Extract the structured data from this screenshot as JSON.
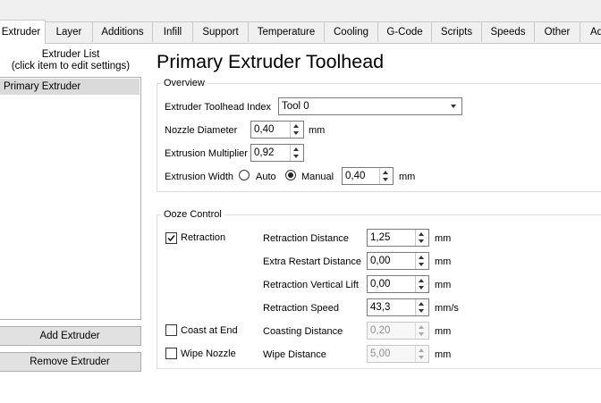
{
  "tabs": [
    {
      "label": "Extruder",
      "active": true
    },
    {
      "label": "Layer"
    },
    {
      "label": "Additions"
    },
    {
      "label": "Infill"
    },
    {
      "label": "Support"
    },
    {
      "label": "Temperature"
    },
    {
      "label": "Cooling"
    },
    {
      "label": "G-Code"
    },
    {
      "label": "Scripts"
    },
    {
      "label": "Speeds"
    },
    {
      "label": "Other"
    },
    {
      "label": "Ad"
    }
  ],
  "left_panel": {
    "list_title_line1": "Extruder List",
    "list_title_line2": "(click item to edit settings)",
    "items": [
      "Primary Extruder"
    ],
    "add_button": "Add Extruder",
    "remove_button": "Remove Extruder"
  },
  "page_title": "Primary Extruder Toolhead",
  "overview": {
    "title": "Overview",
    "toolhead_index_label": "Extruder Toolhead Index",
    "toolhead_index_value": "Tool 0",
    "nozzle_diameter_label": "Nozzle Diameter",
    "nozzle_diameter_value": "0,40",
    "nozzle_diameter_unit": "mm",
    "extrusion_multiplier_label": "Extrusion Multiplier",
    "extrusion_multiplier_value": "0,92",
    "extrusion_width_label": "Extrusion Width",
    "auto_label": "Auto",
    "manual_label": "Manual",
    "extrusion_width_mode": "Manual",
    "extrusion_width_value": "0,40",
    "extrusion_width_unit": "mm"
  },
  "ooze": {
    "title": "Ooze Control",
    "retraction_label": "Retraction",
    "retraction_checked": true,
    "coast_label": "Coast at End",
    "coast_checked": false,
    "wipe_label": "Wipe Nozzle",
    "wipe_checked": false,
    "retraction_distance_label": "Retraction Distance",
    "retraction_distance_value": "1,25",
    "retraction_distance_unit": "mm",
    "extra_restart_label": "Extra Restart Distance",
    "extra_restart_value": "0,00",
    "extra_restart_unit": "mm",
    "vertical_lift_label": "Retraction Vertical Lift",
    "vertical_lift_value": "0,00",
    "vertical_lift_unit": "mm",
    "retraction_speed_label": "Retraction Speed",
    "retraction_speed_value": "43,3",
    "retraction_speed_unit": "mm/s",
    "coasting_distance_label": "Coasting Distance",
    "coasting_distance_value": "0,20",
    "coasting_distance_unit": "mm",
    "wipe_distance_label": "Wipe Distance",
    "wipe_distance_value": "5,00",
    "wipe_distance_unit": "mm"
  }
}
